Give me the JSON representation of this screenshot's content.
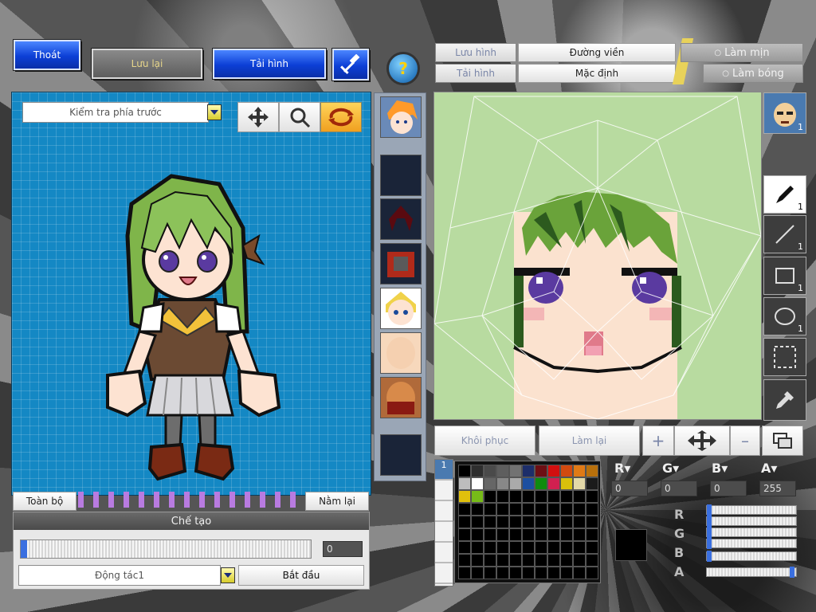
{
  "top_left": {
    "exit_label": "Thoát",
    "save_label": "Lưu lại",
    "reload_label": "Tải hình",
    "hammer_icon": "hammer-icon",
    "help_icon": "question-icon"
  },
  "left": {
    "view_select": "Kiểm tra phía trước",
    "tools": [
      "move-icon",
      "search-icon",
      "rotate-icon"
    ],
    "all_label": "Toàn bộ",
    "lie_label": "Nằm lại",
    "create_header": "Chế tạo",
    "progress_value": "0",
    "action_select": "Động tác1",
    "start_label": "Bắt đầu"
  },
  "right_top": {
    "save_label": "Lưu hình",
    "reload_label": "Tải hình",
    "outline_label": "Đường viền",
    "default_label": "Mặc định",
    "smooth_label": "Làm mịn",
    "shine_label": "Làm bóng"
  },
  "right_bottom": {
    "restore_label": "Khôi phục",
    "redo_label": "Làm lại"
  },
  "side_tools": [
    {
      "name": "avatar-icon",
      "count": "1"
    },
    {
      "name": "pen-icon",
      "count": "1"
    },
    {
      "name": "line-icon",
      "count": "1"
    },
    {
      "name": "rectangle-icon",
      "count": "1"
    },
    {
      "name": "ellipse-icon",
      "count": "1"
    },
    {
      "name": "selection-icon",
      "count": ""
    },
    {
      "name": "eyedropper-icon",
      "count": ""
    }
  ],
  "color": {
    "r_value": "0",
    "g_value": "0",
    "b_value": "0",
    "a_value": "255",
    "current": "#000000",
    "palette_row1": [
      "#000000",
      "#2e2e2e",
      "#4a4a4a",
      "#5e5e5e",
      "#727272",
      "#1d2e6a",
      "#6d0f14",
      "#d20f0f",
      "#d24a0f",
      "#e07a16",
      "#b8700c"
    ],
    "palette_row2": [
      "#bdbdbd",
      "#ffffff",
      "#666666",
      "#888888",
      "#aaaaaa",
      "#1d4fa0",
      "#0e8c0e",
      "#d12050",
      "#d9c00c",
      "#e3d8a8",
      "#1b1b1b"
    ],
    "palette_row3": [
      "#e0c00c",
      "#77bb18"
    ]
  }
}
